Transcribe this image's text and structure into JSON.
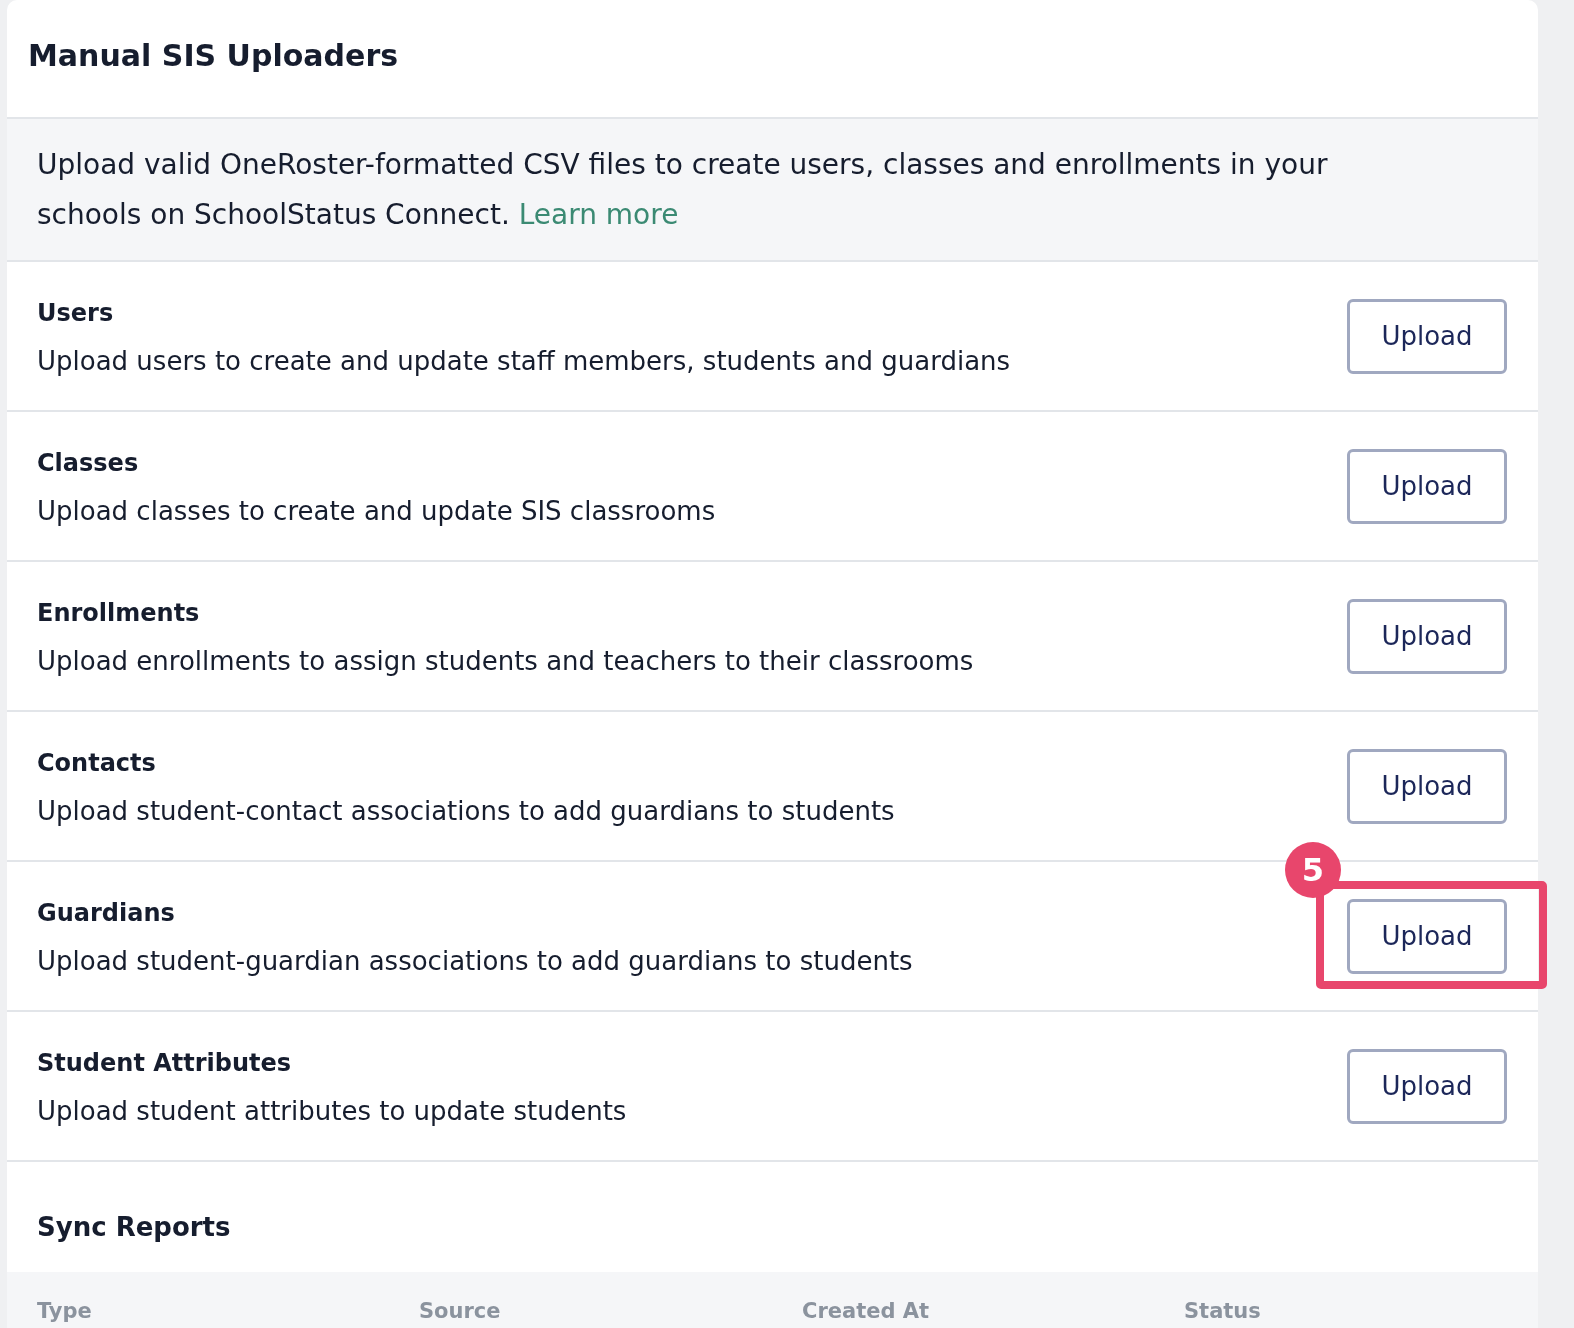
{
  "panel": {
    "title": "Manual SIS Uploaders"
  },
  "intro": {
    "text": "Upload valid OneRoster-formatted CSV files to create users, classes and enrollments in your schools on SchoolStatus Connect.",
    "link": "Learn more"
  },
  "uploaders": [
    {
      "name": "Users",
      "description": "Upload users to create and update staff members, students and guardians",
      "button": "Upload",
      "highlighted": false
    },
    {
      "name": "Classes",
      "description": "Upload classes to create and update SIS classrooms",
      "button": "Upload",
      "highlighted": false
    },
    {
      "name": "Enrollments",
      "description": "Upload enrollments to assign students and teachers to their classrooms",
      "button": "Upload",
      "highlighted": false
    },
    {
      "name": "Contacts",
      "description": "Upload student-contact associations to add guardians to students",
      "button": "Upload",
      "highlighted": false
    },
    {
      "name": "Guardians",
      "description": "Upload student-guardian associations to add guardians to students",
      "button": "Upload",
      "highlighted": true,
      "callout": "5"
    },
    {
      "name": "Student Attributes",
      "description": "Upload student attributes to update students",
      "button": "Upload",
      "highlighted": false
    }
  ],
  "sync_reports": {
    "title": "Sync Reports",
    "columns": [
      "Type",
      "Source",
      "Created At",
      "Status"
    ]
  }
}
